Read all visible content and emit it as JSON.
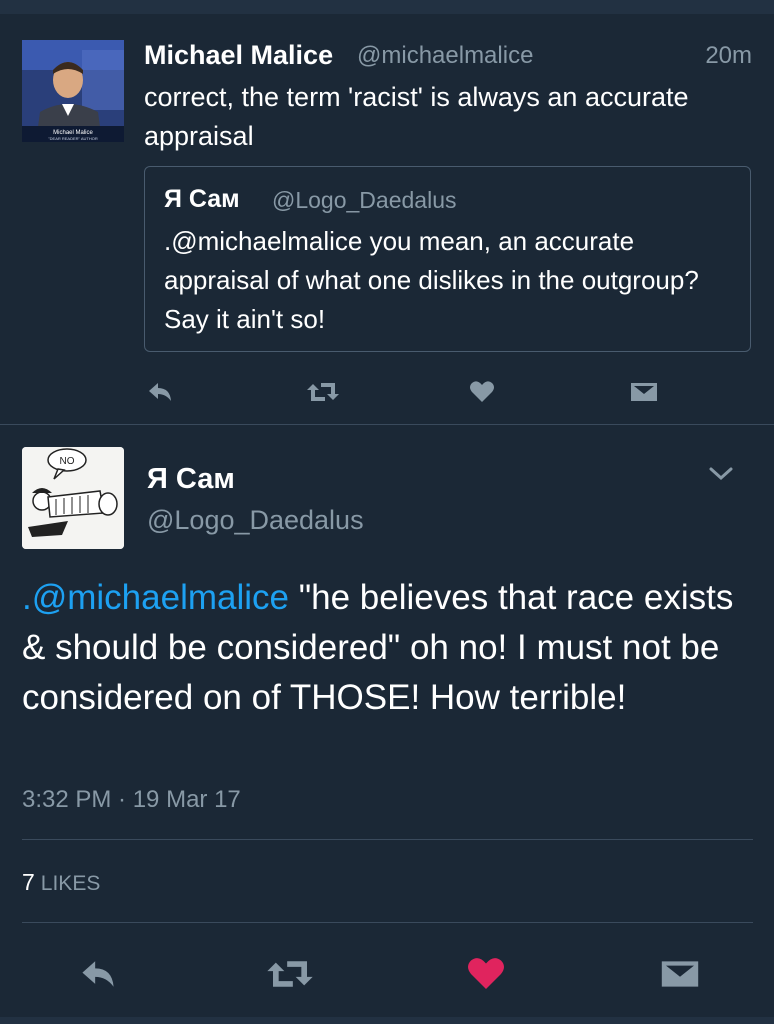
{
  "tweet1": {
    "name": "Michael Malice",
    "handle": "@michaelmalice",
    "time": "20m",
    "text": "correct, the term 'racist' is always an accurate appraisal",
    "avatar_caption_name": "Michael Malice",
    "avatar_caption_title": "\"DEAR READER\" AUTHOR",
    "quote": {
      "name": "Я Сам",
      "handle": "@Logo_Daedalus",
      "text": ".@michaelmalice you mean, an accurate appraisal of what one dislikes in the outgroup? Say it ain't so!"
    }
  },
  "tweet2": {
    "name": "Я Сам",
    "handle": "@Logo_Daedalus",
    "mention": ".@michaelmalice",
    "text": " \"he believes that race exists & should be considered\" oh no! I must not be considered on of THOSE! How terrible!",
    "timestamp": "3:32 PM · 19 Mar 17",
    "likes_count": "7",
    "likes_label": "LIKES",
    "avatar_bubble": "NO"
  },
  "icons": {
    "reply": "reply-icon",
    "retweet": "retweet-icon",
    "like": "heart-icon",
    "dm": "envelope-icon",
    "more": "chevron-down-icon"
  },
  "colors": {
    "background": "#1b2836",
    "mention": "#1da1f2",
    "muted": "#8899a6",
    "like_active": "#e0245e"
  }
}
